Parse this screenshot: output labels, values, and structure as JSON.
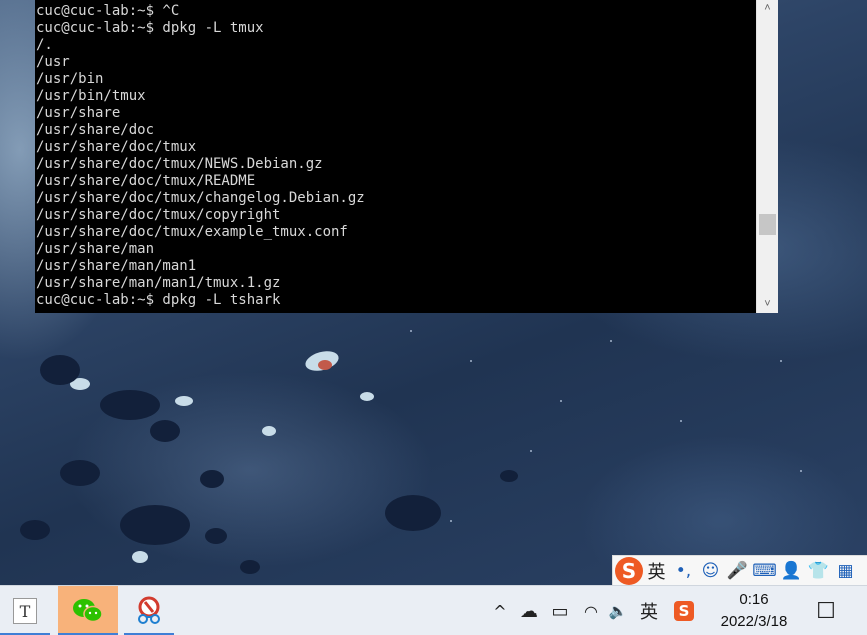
{
  "terminal": {
    "lines": [
      "cuc@cuc-lab:~$ ^C",
      "cuc@cuc-lab:~$ dpkg -L tmux",
      "/.",
      "/usr",
      "/usr/bin",
      "/usr/bin/tmux",
      "/usr/share",
      "/usr/share/doc",
      "/usr/share/doc/tmux",
      "/usr/share/doc/tmux/NEWS.Debian.gz",
      "/usr/share/doc/tmux/README",
      "/usr/share/doc/tmux/changelog.Debian.gz",
      "/usr/share/doc/tmux/copyright",
      "/usr/share/doc/tmux/example_tmux.conf",
      "/usr/share/man",
      "/usr/share/man/man1",
      "/usr/share/man/man1/tmux.1.gz",
      "cuc@cuc-lab:~$ dpkg -L tshark"
    ],
    "scroll_up_glyph": "˄",
    "scroll_down_glyph": "˅"
  },
  "ime_toolbar": {
    "logo_letter": "S",
    "items": [
      {
        "icon": "chinese-english-toggle",
        "glyph": "英"
      },
      {
        "icon": "punctuation-icon",
        "glyph": "•,"
      },
      {
        "icon": "emoji-icon",
        "glyph": "☺"
      },
      {
        "icon": "microphone-icon",
        "glyph": "🎤"
      },
      {
        "icon": "keyboard-icon",
        "glyph": "⌨"
      },
      {
        "icon": "user-card-icon",
        "glyph": "👤"
      },
      {
        "icon": "skin-icon",
        "glyph": "👕"
      },
      {
        "icon": "toolbox-icon",
        "glyph": "▦"
      }
    ]
  },
  "taskbar": {
    "apps": [
      {
        "name": "typora",
        "letter": "T",
        "active": true
      },
      {
        "name": "wechat",
        "active": true
      },
      {
        "name": "network-tool",
        "active": true
      }
    ],
    "tray": {
      "show_hidden_glyph": "^",
      "cloud_glyph": "☁",
      "battery_glyph": "▭",
      "wifi_glyph": "◠",
      "volume_glyph": "🔈",
      "input_lang": "英",
      "ime_letter": "S",
      "notification_glyph": "☐"
    },
    "clock": {
      "time": "0:16",
      "date": "2022/3/18"
    }
  },
  "colors": {
    "taskbar_accent": "#3f7fd6",
    "ime_brand": "#ee5a24",
    "terminal_bg": "#000000",
    "terminal_fg": "#d8d8d8"
  }
}
